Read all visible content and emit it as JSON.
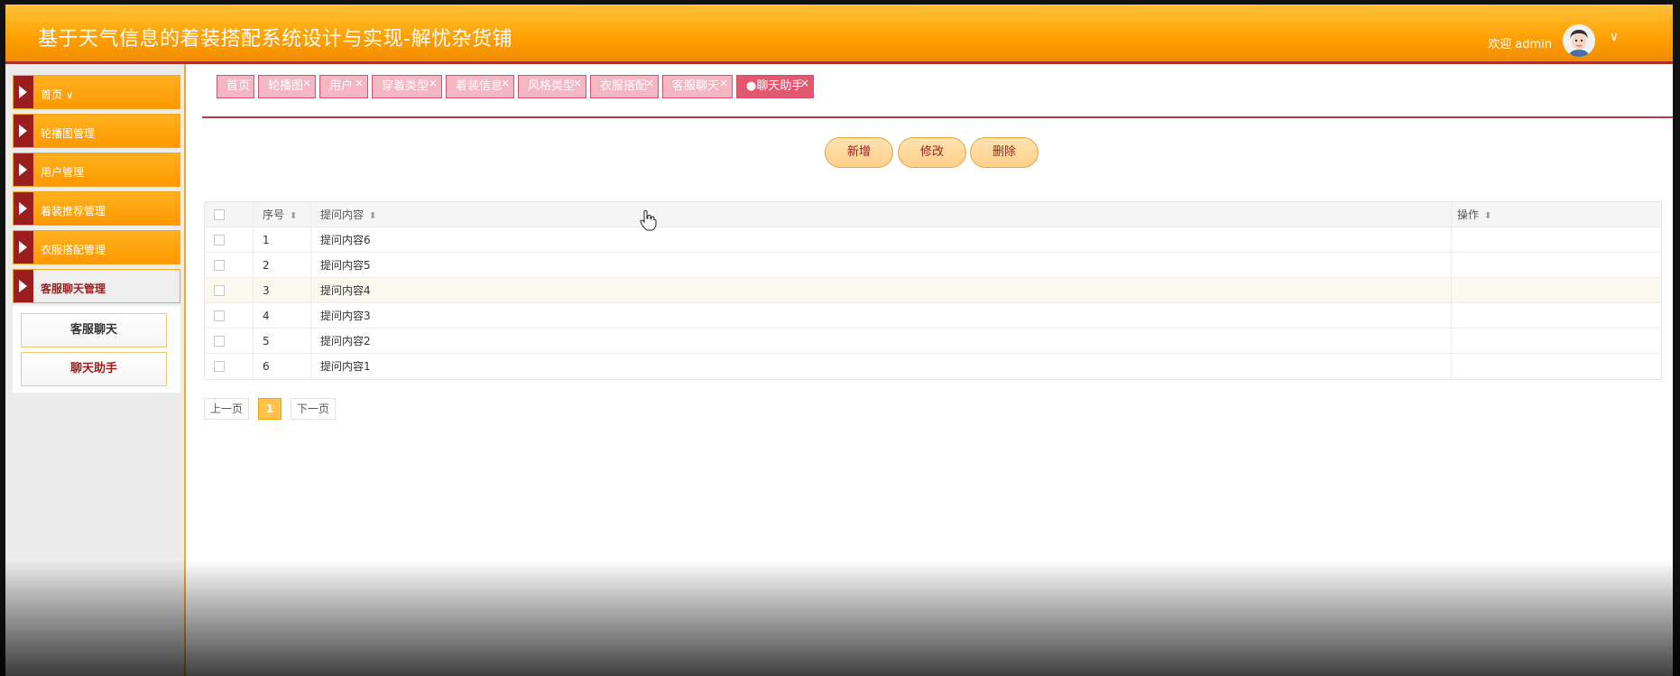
{
  "header": {
    "title": "基于天气信息的着装搭配系统设计与实现-解忧杂货铺",
    "welcome": "欢迎 admin"
  },
  "sidebar": {
    "items": [
      {
        "label": "首页 ∨"
      },
      {
        "label": "轮播图管理"
      },
      {
        "label": "用户管理"
      },
      {
        "label": "着装推荐管理"
      },
      {
        "label": "衣服搭配管理"
      },
      {
        "label": "客服聊天管理"
      }
    ],
    "submenu": [
      {
        "label": "客服聊天"
      },
      {
        "label": "聊天助手"
      }
    ]
  },
  "tabs": [
    {
      "label": "首页"
    },
    {
      "label": "轮播图"
    },
    {
      "label": "用户"
    },
    {
      "label": "穿着类型"
    },
    {
      "label": "着装信息"
    },
    {
      "label": "风格类型"
    },
    {
      "label": "衣服搭配"
    },
    {
      "label": "客服聊天"
    },
    {
      "label": "●聊天助手"
    }
  ],
  "toolbar": {
    "add_label": "新增",
    "edit_label": "修改",
    "delete_label": "删除"
  },
  "table": {
    "columns": [
      "序号",
      "提问内容",
      "操作"
    ],
    "rows": [
      {
        "no": "1",
        "question": "提问内容6"
      },
      {
        "no": "2",
        "question": "提问内容5"
      },
      {
        "no": "3",
        "question": "提问内容4"
      },
      {
        "no": "4",
        "question": "提问内容3"
      },
      {
        "no": "5",
        "question": "提问内容2"
      },
      {
        "no": "6",
        "question": "提问内容1"
      }
    ]
  },
  "pager": {
    "prev": "上一页",
    "current": "1",
    "next": "下一页"
  },
  "colors": {
    "header": "#ff9f00",
    "accent": "#9b1e1e",
    "tab": "#f4b6c2",
    "tab_active": "#e4586f"
  }
}
